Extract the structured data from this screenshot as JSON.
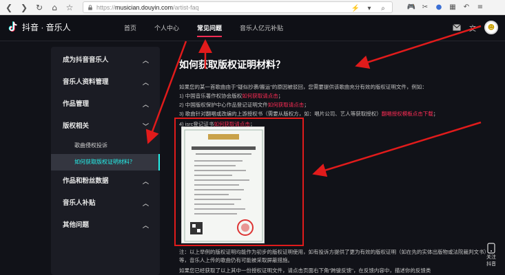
{
  "browser": {
    "url_protocol": "https://",
    "url_domain": "musician.douyin.com",
    "url_path": "/artist-faq",
    "nav_icons": [
      "back-icon",
      "forward-icon",
      "reload-icon",
      "home-icon",
      "star-icon"
    ]
  },
  "header": {
    "logo_text": "抖音 · 音乐人",
    "nav": [
      "首页",
      "个人中心",
      "常见问题",
      "音乐人亿元补贴"
    ],
    "active_nav": "常见问题"
  },
  "sidebar": {
    "items": [
      {
        "label": "成为抖音音乐人",
        "chevron": "^"
      },
      {
        "label": "音乐人资料管理",
        "chevron": "^"
      },
      {
        "label": "作品管理",
        "chevron": "^"
      },
      {
        "label": "版权相关",
        "chevron": "v"
      }
    ],
    "sub_items": [
      "歌曲侵权投诉",
      "如何获取版权证明材料？"
    ],
    "items_after": [
      {
        "label": "作品和粉丝数据",
        "chevron": "^"
      },
      {
        "label": "音乐人补贴",
        "chevron": "^"
      },
      {
        "label": "其他问题",
        "chevron": "^"
      }
    ]
  },
  "article": {
    "title": "如何获取版权证明材料？",
    "intro": "如果您的某一首歌曲由于\"疑似抄袭/搬运\"的原因被驳回，您需要提供该歌曲充分有效的版权证明文件，例如：",
    "items": [
      {
        "text": "1) 中国音乐著作权协会版权",
        "link": "如何获取请点击",
        "tail": "；"
      },
      {
        "text": "2) 中国版权保护中心作品登记证明文件",
        "link": "如何获取请点击",
        "tail": "；"
      },
      {
        "text": "3) 歌曲针对翻唱或改编的上游授权书（需要从版权方，如：唱片公司、艺人等获取授权）",
        "link": "翻唱授权模板点击下载",
        "tail": "；"
      },
      {
        "text": "4) isrc登记证书",
        "link": "如何获取请点击",
        "tail": "；"
      }
    ],
    "note_1": "注：以上举例的版权证明均能作为初步的版权证明使用，如有投诉方提供了更为有效的版权证明（如在先的实体出版物或法院裁判文书）等，音乐人上传的歌曲仍有可能被采取屏蔽措施。",
    "note_2": "如果您已经获取了以上其中一份授权证明文件，请点击页面右下角\"跨骏反馈\"，在反馈内容中，描述你的反馈类"
  },
  "certificate": {
    "heading": "ISRC 版权登记（转版）证书"
  },
  "follow": {
    "label_1": "关注",
    "label_2": "抖音"
  },
  "colors": {
    "accent_red": "#fe2c55",
    "accent_cyan": "#25f4ee",
    "annotation_red": "#e11b1b"
  }
}
